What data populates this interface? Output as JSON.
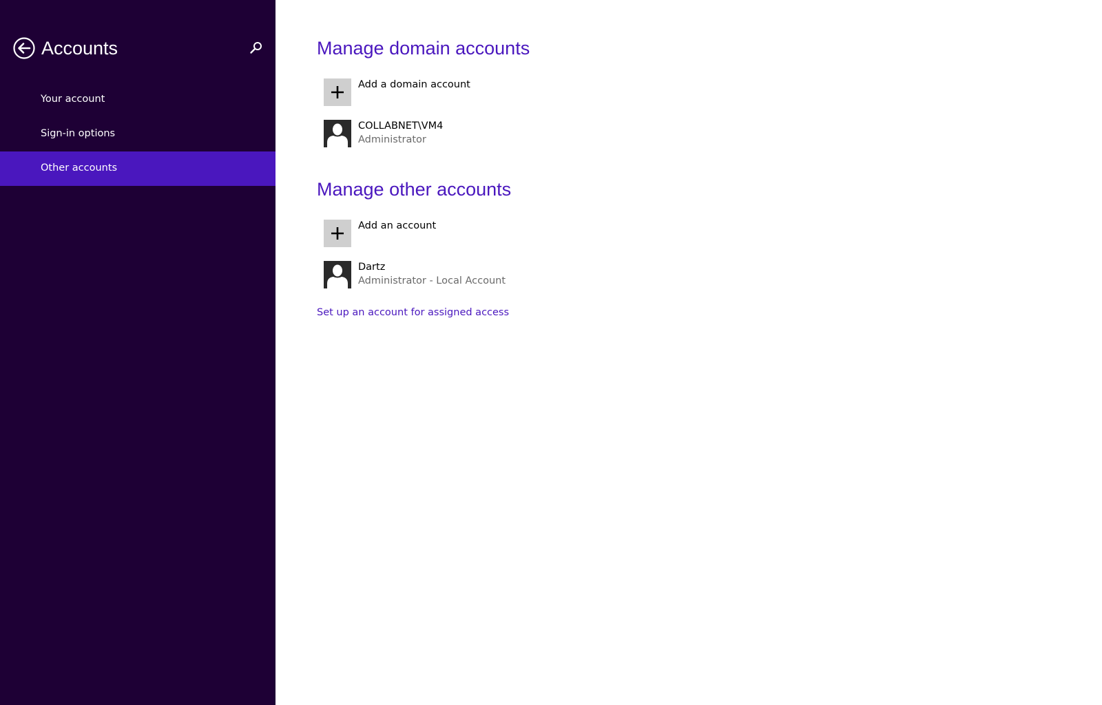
{
  "sidebar": {
    "title": "Accounts",
    "back_icon": "back-arrow-circle-icon",
    "search_icon": "search-icon",
    "items": [
      {
        "label": "Your account",
        "selected": false
      },
      {
        "label": "Sign-in options",
        "selected": false
      },
      {
        "label": "Other accounts",
        "selected": true
      }
    ]
  },
  "main": {
    "domain_section": {
      "title": "Manage domain accounts",
      "add_label": "Add a domain account",
      "accounts": [
        {
          "name": "COLLABNET\\VM4",
          "role": "Administrator"
        }
      ]
    },
    "other_section": {
      "title": "Manage other accounts",
      "add_label": "Add an account",
      "accounts": [
        {
          "name": "Dartz",
          "role": "Administrator - Local Account"
        }
      ]
    },
    "assigned_access_link": "Set up an account for assigned access"
  },
  "colors": {
    "sidebar_bg": "#1e0035",
    "selected_bg": "#4a17be",
    "accent": "#4a17be",
    "tile_add_bg": "#cfcfcf",
    "tile_user_bg": "#2a2a2a"
  }
}
